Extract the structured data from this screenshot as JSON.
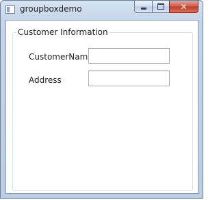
{
  "window": {
    "title": "groupboxdemo"
  },
  "titlebar": {
    "minimize_glyph": "minimize-icon",
    "maximize_glyph": "maximize-icon",
    "close_label": "✕"
  },
  "group": {
    "legend": "Customer Information",
    "fields": [
      {
        "label": "CustomerName",
        "value": ""
      },
      {
        "label": "Address",
        "value": ""
      }
    ]
  }
}
